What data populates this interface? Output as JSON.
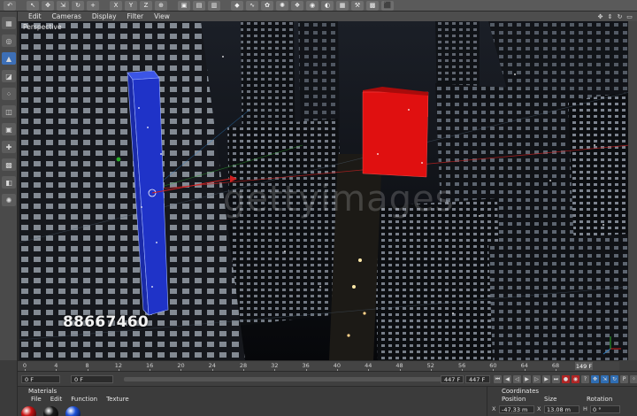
{
  "toolbar": {
    "buttons": [
      {
        "name": "undo-button",
        "glyph": "↶"
      },
      {
        "name": "live-select-button",
        "glyph": "↖"
      },
      {
        "name": "move-button",
        "glyph": "✥"
      },
      {
        "name": "scale-button",
        "glyph": "⇲"
      },
      {
        "name": "rotate-button",
        "glyph": "↻"
      },
      {
        "name": "add-button",
        "glyph": "+"
      },
      {
        "name": "x-axis-button",
        "glyph": "X"
      },
      {
        "name": "y-axis-button",
        "glyph": "Y"
      },
      {
        "name": "z-axis-button",
        "glyph": "Z"
      },
      {
        "name": "coordinate-system-button",
        "glyph": "⊕"
      },
      {
        "name": "render-view-button",
        "glyph": "▣"
      },
      {
        "name": "render-picture-button",
        "glyph": "▤"
      },
      {
        "name": "render-settings-button",
        "glyph": "▥"
      },
      {
        "name": "cube-object-button",
        "glyph": "◆"
      },
      {
        "name": "spline-button",
        "glyph": "∿"
      },
      {
        "name": "nurbs-button",
        "glyph": "✿"
      },
      {
        "name": "array-button",
        "glyph": "✺"
      },
      {
        "name": "deformer-button",
        "glyph": "❖"
      },
      {
        "name": "scene-button",
        "glyph": "◉"
      },
      {
        "name": "camera-button",
        "glyph": "◐"
      },
      {
        "name": "light-button",
        "glyph": "▦"
      },
      {
        "name": "sculpt-button",
        "glyph": "⚒"
      },
      {
        "name": "layout-button",
        "glyph": "▩"
      },
      {
        "name": "python-button",
        "glyph": "⬛"
      }
    ]
  },
  "viewport_menu": {
    "items": [
      "Edit",
      "Cameras",
      "Display",
      "Filter",
      "View"
    ]
  },
  "viewport": {
    "label": "Perspective",
    "watermark_number": "88667460",
    "watermark_logo": "gettyimages"
  },
  "timeline": {
    "ticks": [
      "0",
      "4",
      "8",
      "12",
      "16",
      "20",
      "24",
      "28",
      "32",
      "36",
      "40",
      "44",
      "48",
      "52",
      "56",
      "60",
      "64",
      "68"
    ],
    "current_frame": "149 F",
    "start_field": "0 F",
    "min_field": "0 F",
    "end_field": "447 F",
    "max_field": "447 F"
  },
  "materials": {
    "title": "Materials",
    "menu": [
      "File",
      "Edit",
      "Function",
      "Texture"
    ],
    "swatches": [
      "#c81414",
      "#1a1a1a",
      "#1c4fd6"
    ]
  },
  "coordinates": {
    "title": "Coordinates",
    "headers": [
      "Position",
      "Size",
      "Rotation"
    ],
    "fields": [
      {
        "axis": "X",
        "value": "-47.33 m"
      },
      {
        "axis": "X",
        "value": "13.08 m"
      },
      {
        "axis": "H",
        "value": "0 °"
      }
    ]
  },
  "colors": {
    "blue_object": "#1f33c8",
    "red_object": "#e01010",
    "accent": "#3d6fb6"
  }
}
